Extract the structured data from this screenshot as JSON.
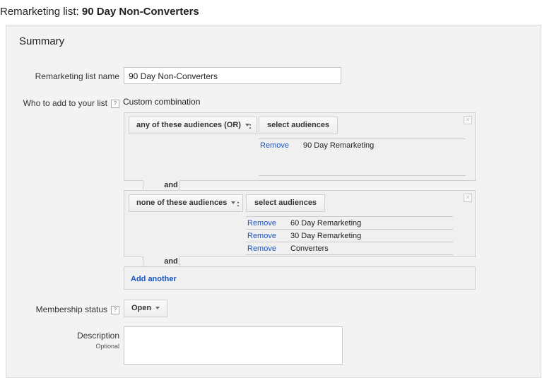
{
  "page": {
    "title_prefix": "Remarketing list:",
    "title_name": "90 Day Non-Converters"
  },
  "summary": {
    "heading": "Summary"
  },
  "list_name": {
    "label": "Remarketing list name",
    "value": "90 Day Non-Converters"
  },
  "who_to_add": {
    "label": "Who to add to your list",
    "help": "?",
    "mode": "Custom combination"
  },
  "groups": [
    {
      "operator": "any of these audiences (OR)",
      "select_label": "select audiences",
      "audiences": [
        {
          "remove": "Remove",
          "name": "90 Day Remarketing"
        }
      ]
    },
    {
      "operator": "none of these audiences",
      "select_label": "select audiences",
      "audiences": [
        {
          "remove": "Remove",
          "name": "60 Day Remarketing"
        },
        {
          "remove": "Remove",
          "name": "30 Day Remarketing"
        },
        {
          "remove": "Remove",
          "name": "Converters"
        }
      ]
    }
  ],
  "and_label": "and",
  "colon": ":",
  "close_glyph": "×",
  "add_another": "Add another",
  "membership": {
    "label": "Membership status",
    "help": "?",
    "value": "Open"
  },
  "description": {
    "label": "Description",
    "sub": "Optional",
    "value": ""
  }
}
